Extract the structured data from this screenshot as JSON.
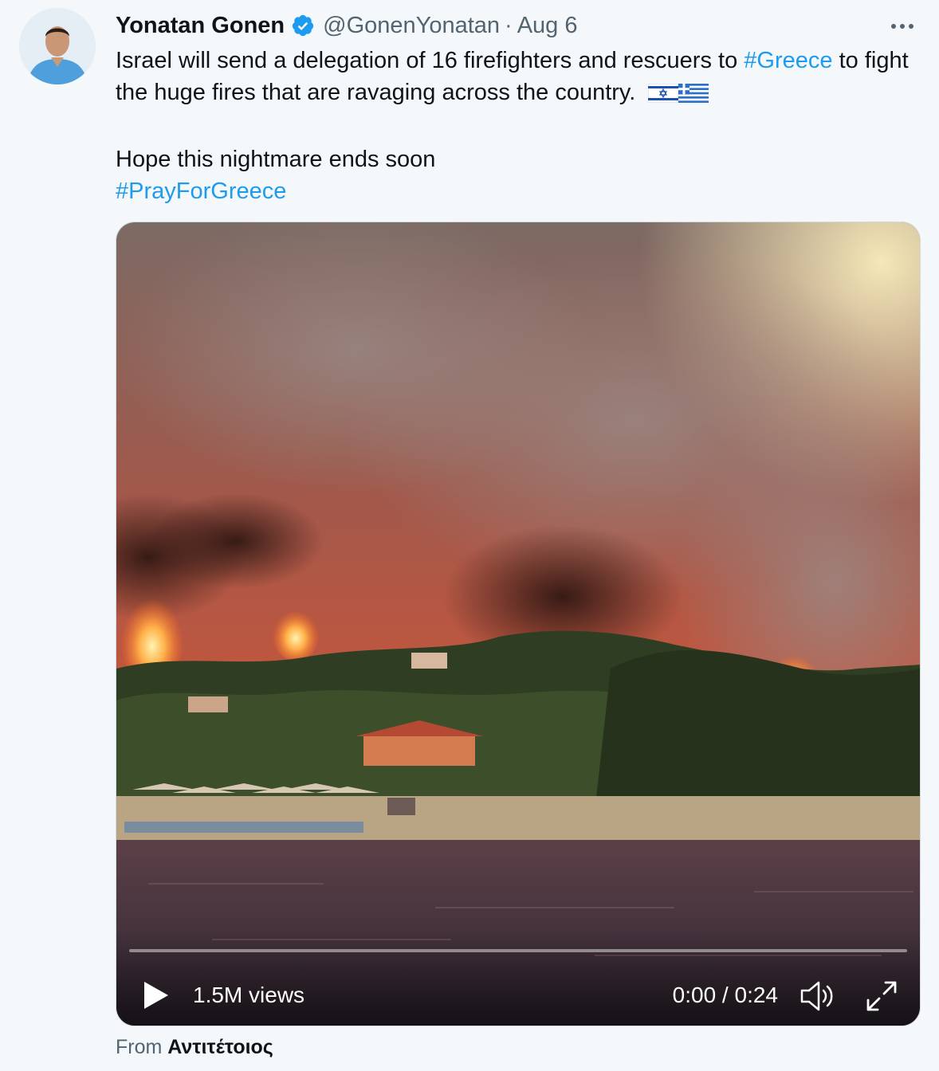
{
  "tweet": {
    "author_name": "Yonatan Gonen",
    "handle": "@GonenYonatan",
    "separator": "·",
    "date": "Aug 6",
    "text_part1": "Israel will send a delegation of 16 firefighters and rescuers to ",
    "hashtag_greece": "#Greece",
    "text_part2": " to fight the huge fires that are ravaging across the country.",
    "flags": [
      "flag-israel-icon",
      "flag-greece-icon"
    ],
    "line_hope": "Hope this nightmare ends soon",
    "hashtag_pray": "#PrayForGreece"
  },
  "video": {
    "views": "1.5M views",
    "time": "0:00 / 0:24",
    "progress": 0,
    "icons": [
      "play-icon",
      "volume-icon",
      "fullscreen-icon"
    ]
  },
  "source": {
    "prefix": "From",
    "name": "Αντιτέτοιος"
  },
  "colors": {
    "link": "#1d9bf0",
    "verified": "#1d9bf0",
    "secondary_text": "#536471",
    "background": "#f5f8fa"
  }
}
